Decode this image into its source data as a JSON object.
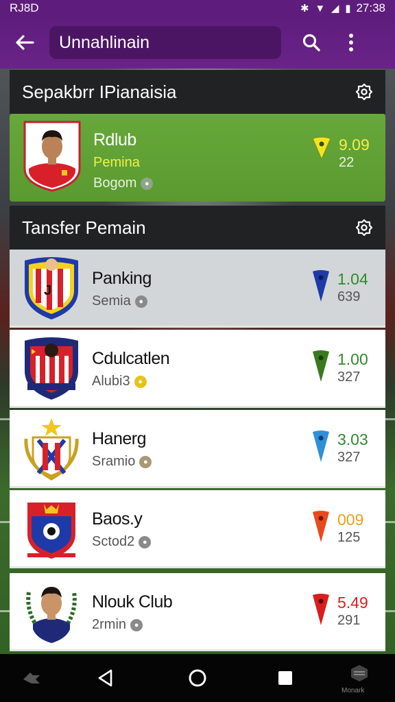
{
  "status_bar": {
    "left_text": "RJ8D",
    "time": "27:38"
  },
  "app_bar": {
    "search_value": "Unnahlinain",
    "back_icon": "arrow-left-icon",
    "search_icon": "search-icon",
    "more_icon": "more-vert-icon"
  },
  "sections": {
    "top": {
      "title": "Sepakbrr IPianaisia"
    },
    "transfers": {
      "title": "Tansfer Pemain"
    }
  },
  "featured": {
    "name": "Rdlub",
    "subtitle": "Pemina",
    "meta": "Bogom",
    "score": "9.09",
    "count": "22",
    "rating_color": "#f1e51e"
  },
  "rows": [
    {
      "title": "Panking",
      "meta": "Semia",
      "score": "1.04",
      "count": "639",
      "rating_color": "#1e3aa8",
      "score_color": "#2d8a2d",
      "dot_color": "#8a8a8a"
    },
    {
      "title": "Cdulcatlen",
      "meta": "Alubi3",
      "score": "1.00",
      "count": "327",
      "rating_color": "#3a7a1e",
      "score_color": "#2d8a2d",
      "dot_color": "#e6c318"
    },
    {
      "title": "Hanerg",
      "meta": "Sramio",
      "score": "3.03",
      "count": "327",
      "rating_color": "#2f8fd8",
      "score_color": "#2d8a2d",
      "dot_color": "#a89877"
    },
    {
      "title": "Baos.y",
      "meta": "Sctod2",
      "score": "009",
      "count": "125",
      "rating_color": "#e84a1e",
      "score_color": "#e8a01e",
      "dot_color": "#8a8a8a"
    },
    {
      "title": "Nlouk Club",
      "meta": "2rmin",
      "score": "5.49",
      "count": "291",
      "rating_color": "#d81e1e",
      "score_color": "#d81e1e",
      "dot_color": "#8a8a8a"
    }
  ],
  "nav_bar": {
    "brand_label": "Monark"
  },
  "colors": {
    "accent": "#5e1d7c",
    "featured_bg": "#67a83a",
    "header_bg": "#202224"
  }
}
